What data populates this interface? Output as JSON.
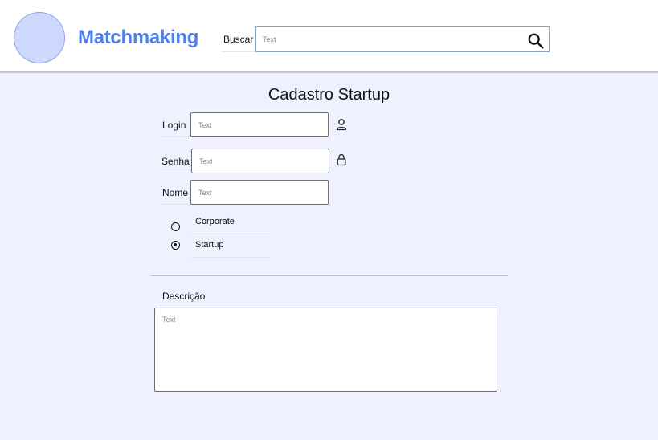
{
  "header": {
    "brand": "Matchmaking",
    "search": {
      "label": "Buscar",
      "placeholder": "Text",
      "icon": "search-icon"
    }
  },
  "colors": {
    "brand": "#4f7ff0",
    "logo_fill": "#ccd8fc",
    "background": "#eff2fe",
    "divider": "#a9bde6"
  },
  "form": {
    "title": "Cadastro Startup",
    "login": {
      "label": "Login",
      "placeholder": "Text",
      "icon": "user-icon"
    },
    "senha": {
      "label": "Senha",
      "placeholder": "Text",
      "icon": "lock-icon"
    },
    "nome": {
      "label": "Nome",
      "placeholder": "Text"
    },
    "type_options": [
      {
        "label": "Corporate",
        "selected": false
      },
      {
        "label": "Startup",
        "selected": true
      }
    ],
    "descricao": {
      "label": "Descrição",
      "placeholder": "Text"
    }
  }
}
